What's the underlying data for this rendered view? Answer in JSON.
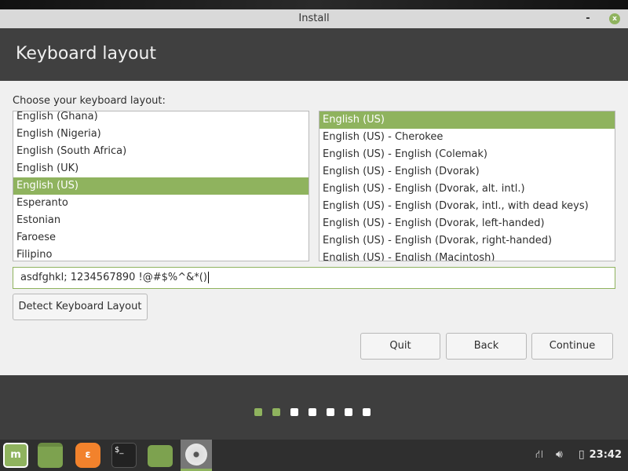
{
  "window": {
    "title": "Install",
    "minimize": "-",
    "close": "x"
  },
  "header": {
    "title": "Keyboard layout"
  },
  "prompt": "Choose your keyboard layout:",
  "layouts": [
    "English (Ghana)",
    "English (Nigeria)",
    "English (South Africa)",
    "English (UK)",
    "English (US)",
    "Esperanto",
    "Estonian",
    "Faroese",
    "Filipino"
  ],
  "layout_selected": "English (US)",
  "variants": [
    "English (US)",
    "English (US) - Cherokee",
    "English (US) - English (Colemak)",
    "English (US) - English (Dvorak)",
    "English (US) - English (Dvorak, alt. intl.)",
    "English (US) - English (Dvorak, intl., with dead keys)",
    "English (US) - English (Dvorak, left-handed)",
    "English (US) - English (Dvorak, right-handed)",
    "English (US) - English (Macintosh)"
  ],
  "variant_selected": "English (US)",
  "test_input": "asdfghkl; 1234567890 !@#$%^&*()",
  "buttons": {
    "detect": "Detect Keyboard Layout",
    "quit": "Quit",
    "back": "Back",
    "continue": "Continue"
  },
  "progress": {
    "steps": 7,
    "completed": 2
  },
  "colors": {
    "accent": "#8fb35e",
    "header": "#404040"
  },
  "taskbar": {
    "clock": "23:42",
    "apps": [
      "mint-menu",
      "show-desktop",
      "firefox",
      "terminal",
      "files",
      "installer"
    ]
  }
}
